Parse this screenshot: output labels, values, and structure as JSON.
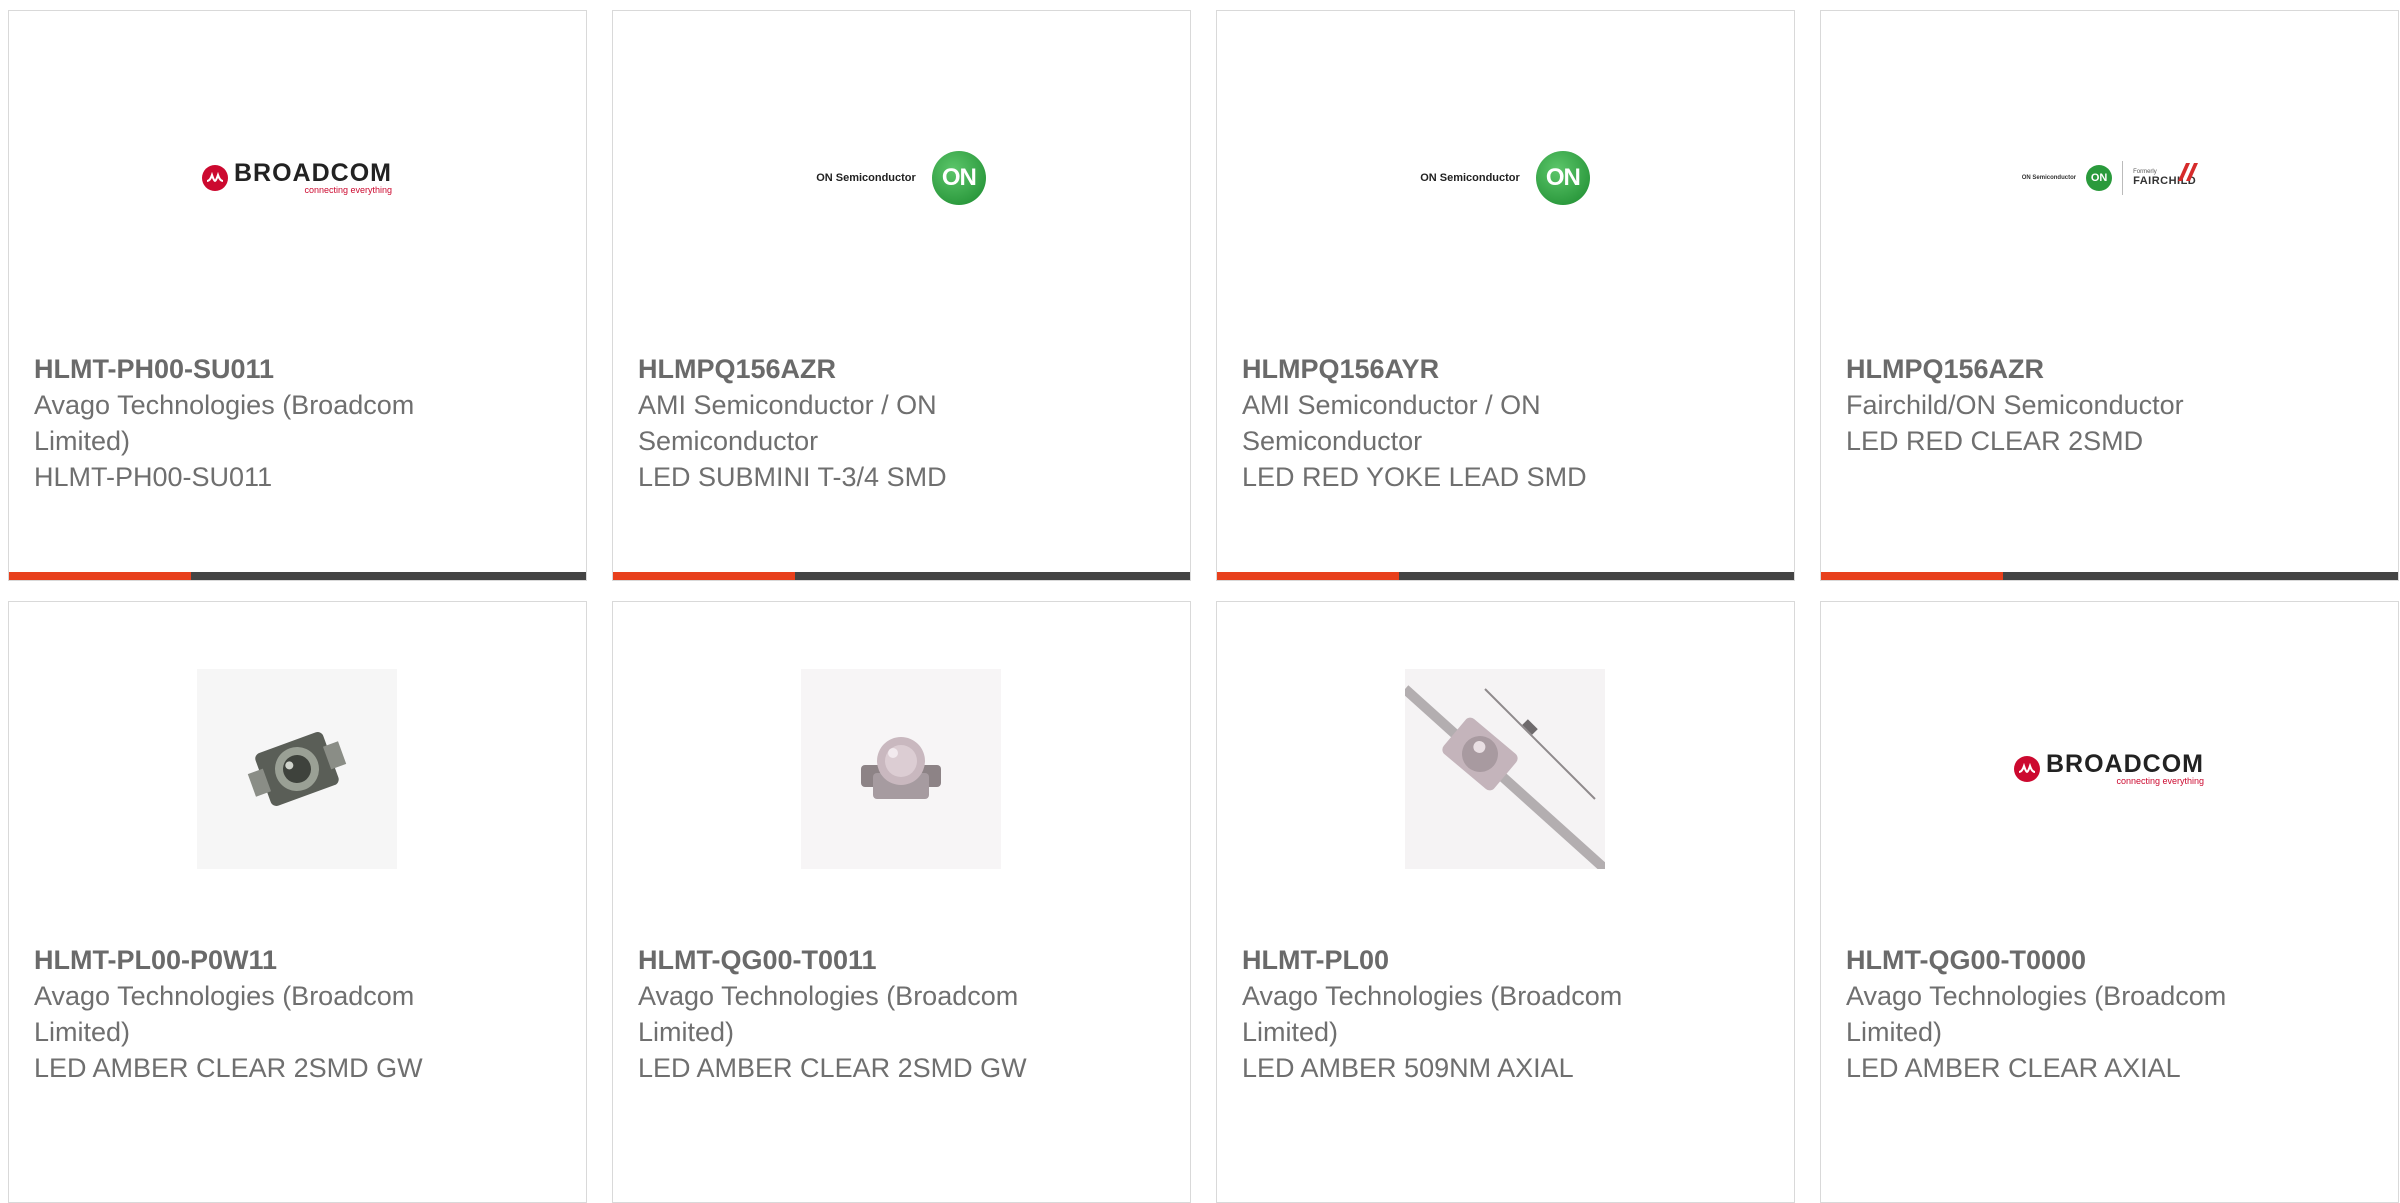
{
  "products": [
    {
      "part_number": "HLMT-PH00-SU011",
      "manufacturer": "Avago Technologies (Broadcom Limited)",
      "description": "HLMT-PH00-SU011",
      "image": "broadcom-logo"
    },
    {
      "part_number": "HLMPQ156AZR",
      "manufacturer": "AMI Semiconductor / ON Semiconductor",
      "description": "LED SUBMINI T-3/4 SMD",
      "image": "on-semiconductor-logo"
    },
    {
      "part_number": "HLMPQ156AYR",
      "manufacturer": "AMI Semiconductor / ON Semiconductor",
      "description": "LED RED YOKE LEAD SMD",
      "image": "on-semiconductor-logo"
    },
    {
      "part_number": "HLMPQ156AZR",
      "manufacturer": "Fairchild/ON Semiconductor",
      "description": "LED RED CLEAR 2SMD",
      "image": "on-fairchild-logo"
    },
    {
      "part_number": "HLMT-PL00-P0W11",
      "manufacturer": "Avago Technologies (Broadcom Limited)",
      "description": "LED AMBER CLEAR 2SMD GW",
      "image": "smd-led-photo"
    },
    {
      "part_number": "HLMT-QG00-T0011",
      "manufacturer": "Avago Technologies (Broadcom Limited)",
      "description": "LED AMBER CLEAR 2SMD GW",
      "image": "smd-led-photo"
    },
    {
      "part_number": "HLMT-PL00",
      "manufacturer": "Avago Technologies (Broadcom Limited)",
      "description": "LED AMBER 509NM AXIAL",
      "image": "axial-led-photo"
    },
    {
      "part_number": "HLMT-QG00-T0000",
      "manufacturer": "Avago Technologies (Broadcom Limited)",
      "description": "LED AMBER CLEAR AXIAL",
      "image": "broadcom-logo"
    }
  ],
  "logos": {
    "broadcom": {
      "name": "BROADCOM",
      "tagline": "connecting everything"
    },
    "on": {
      "text": "ON Semiconductor",
      "mark": "ON"
    },
    "fairchild": {
      "formerly": "Formerly",
      "name": "FAIRCHILD"
    }
  },
  "colors": {
    "accent": "#e8401c",
    "bar": "#444444",
    "text": "#6f6f6f",
    "border": "#d9d9d9"
  }
}
